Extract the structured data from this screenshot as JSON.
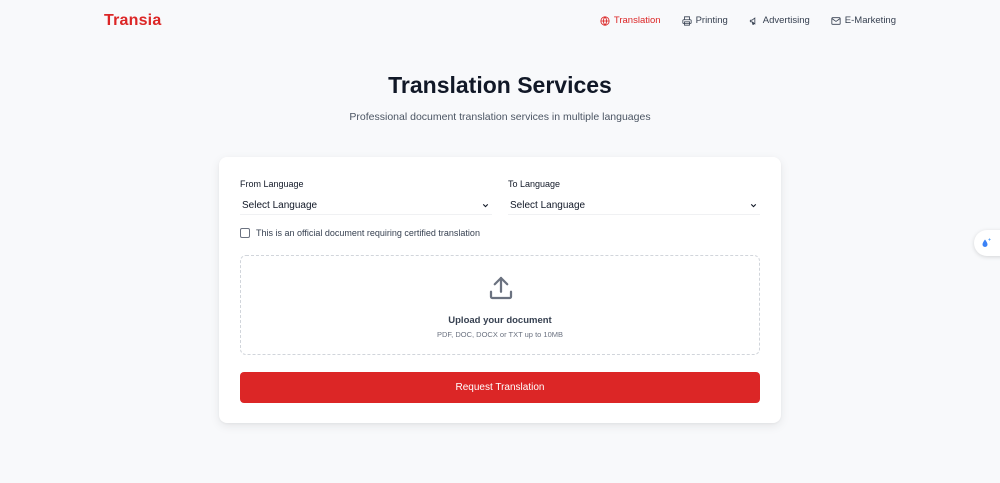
{
  "brand": {
    "name": "Transia",
    "color": "#dc2626"
  },
  "nav": {
    "items": [
      {
        "label": "Translation",
        "icon": "globe-icon",
        "active": true
      },
      {
        "label": "Printing",
        "icon": "printer-icon",
        "active": false
      },
      {
        "label": "Advertising",
        "icon": "megaphone-icon",
        "active": false
      },
      {
        "label": "E-Marketing",
        "icon": "mail-icon",
        "active": false
      }
    ]
  },
  "hero": {
    "title": "Translation Services",
    "subtitle": "Professional document translation services in multiple languages"
  },
  "form": {
    "from": {
      "label": "From Language",
      "value": "Select Language"
    },
    "to": {
      "label": "To Language",
      "value": "Select Language"
    },
    "certified": {
      "label": "This is an official document requiring certified translation",
      "checked": false
    },
    "upload": {
      "title": "Upload your document",
      "hint": "PDF, DOC, DOCX or TXT up to 10MB",
      "icon": "upload-icon"
    },
    "submit_label": "Request Translation"
  },
  "widget": {
    "icon": "droplet-sparkle-icon"
  },
  "colors": {
    "accent": "#dc2626",
    "background": "#f8f9fb",
    "text": "#111827"
  }
}
